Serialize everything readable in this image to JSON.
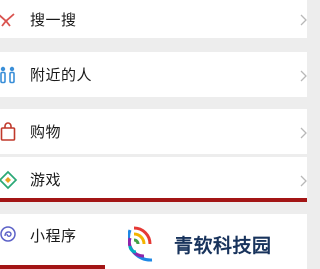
{
  "menu": {
    "items": [
      {
        "label": "搜一搜",
        "icon": "search-sparkle-icon"
      },
      {
        "label": "附近的人",
        "icon": "people-nearby-icon"
      },
      {
        "label": "购物",
        "icon": "shopping-bag-icon"
      },
      {
        "label": "游戏",
        "icon": "game-diamond-icon"
      },
      {
        "label": "小程序",
        "icon": "mini-program-icon"
      }
    ]
  },
  "watermark": {
    "text": "青软科技园",
    "text_color": "#18335c",
    "logo": "signal-waves-logo"
  },
  "colors": {
    "background": "#ededed",
    "item_background": "#ffffff",
    "highlight_bar": "#a31515",
    "search_icon": "#d9534f",
    "nearby_icon": "#3a8fd8",
    "shop_icon": "#c0392b",
    "game_icon_1": "#2aa876",
    "game_icon_2": "#e8a01f",
    "mini_icon": "#5b61c7"
  }
}
